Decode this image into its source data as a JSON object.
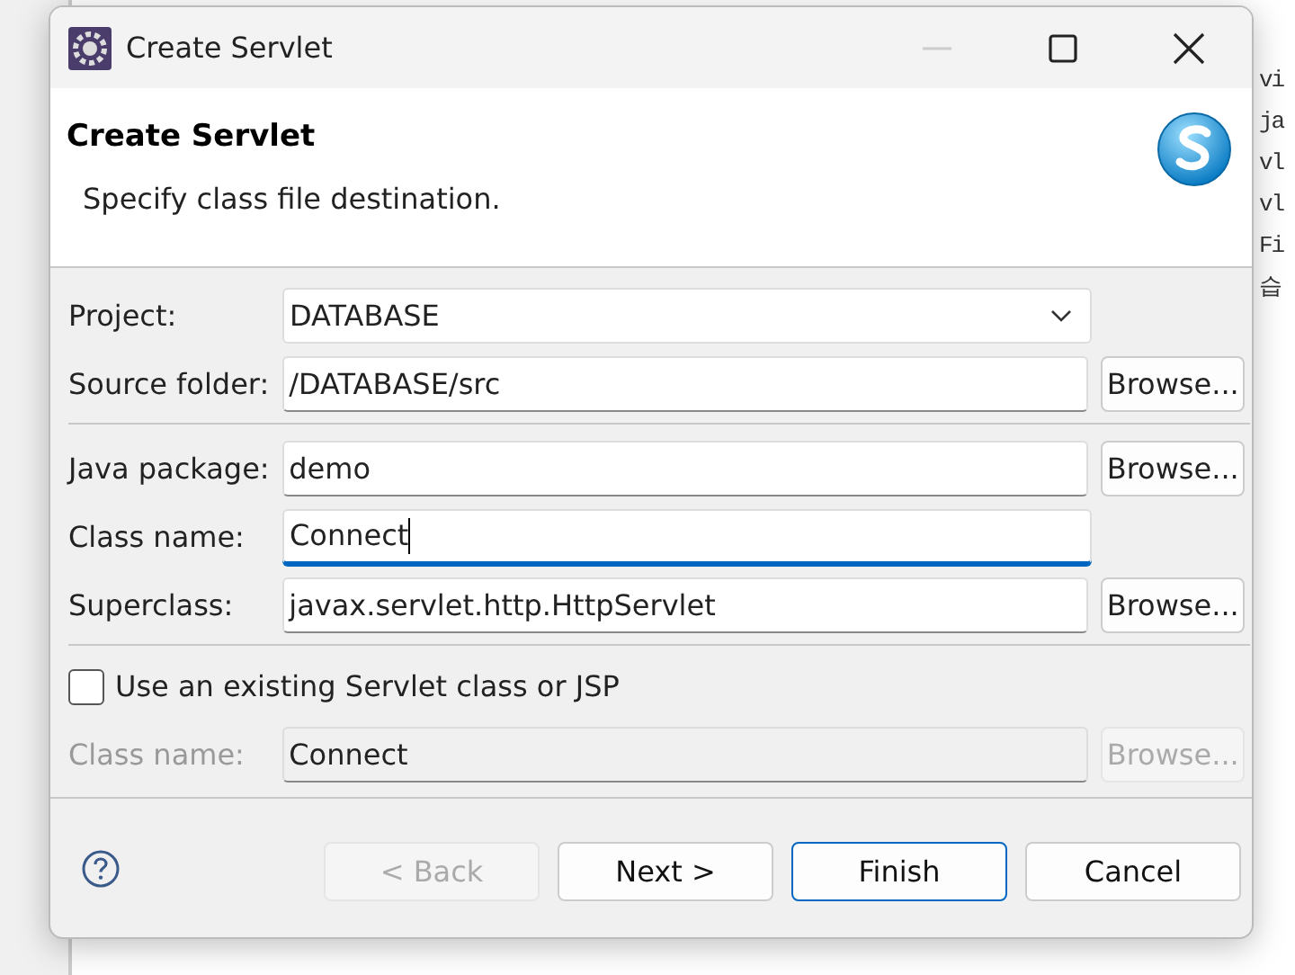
{
  "background": {
    "side_lines": [
      "vi",
      "ja",
      "vl",
      "vl",
      "Fi",
      "습"
    ]
  },
  "window": {
    "title": "Create Servlet"
  },
  "header": {
    "title": "Create Servlet",
    "description": "Specify class file destination."
  },
  "form": {
    "groups": [
      {
        "rows": [
          {
            "label": "Project:",
            "kind": "combo",
            "value": "DATABASE"
          },
          {
            "label": "Source folder:",
            "kind": "text",
            "value": "/DATABASE/src",
            "focused": false,
            "disabled": false,
            "button": {
              "label": "Browse...",
              "disabled": false
            }
          }
        ]
      },
      {
        "rows": [
          {
            "label": "Java package:",
            "kind": "text",
            "value": "demo",
            "focused": false,
            "disabled": false,
            "button": {
              "label": "Browse...",
              "disabled": false
            }
          },
          {
            "label": "Class name:",
            "kind": "text",
            "value": "Connect",
            "focused": true,
            "disabled": false
          },
          {
            "label": "Superclass:",
            "kind": "text",
            "value": "javax.servlet.http.HttpServlet",
            "focused": false,
            "disabled": false,
            "button": {
              "label": "Browse...",
              "disabled": false
            }
          }
        ]
      },
      {
        "rows": [
          {
            "label": "Use an existing Servlet class or JSP",
            "kind": "checkbox",
            "checked": false
          },
          {
            "label": "Class name:",
            "kind": "text",
            "value": "Connect",
            "focused": false,
            "disabled": true,
            "button": {
              "label": "Browse...",
              "disabled": true
            }
          }
        ]
      }
    ]
  },
  "buttons": [
    {
      "label": "< Back",
      "disabled": true,
      "default": false
    },
    {
      "label": "Next >",
      "disabled": false,
      "default": false
    },
    {
      "label": "Finish",
      "disabled": false,
      "default": true
    },
    {
      "label": "Cancel",
      "disabled": false,
      "default": false
    }
  ]
}
